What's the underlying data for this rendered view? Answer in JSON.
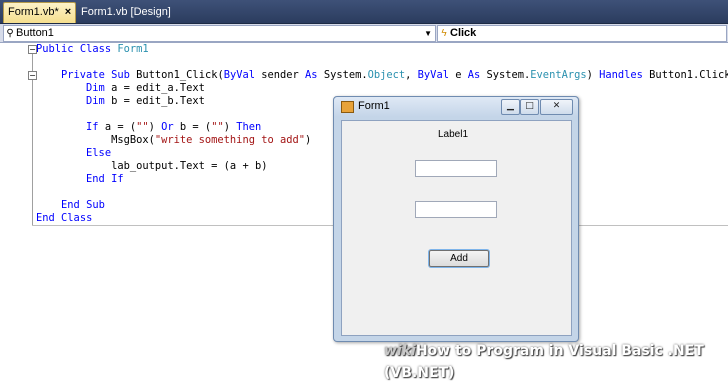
{
  "tabs": [
    {
      "label": "Form1.vb*",
      "close": "×",
      "active": true
    },
    {
      "label": "Form1.vb [Design]",
      "active": false
    }
  ],
  "dropdowns": {
    "object": {
      "value": "Button1",
      "icon": "button-object-icon"
    },
    "event": {
      "value": "Click",
      "icon": "lightning-event-icon"
    }
  },
  "code_lines": [
    "Public Class Form1",
    "",
    "    Private Sub Button1_Click(ByVal sender As System.Object, ByVal e As System.EventArgs) Handles Button1.Click",
    "        Dim a = edit_a.Text",
    "        Dim b = edit_b.Text",
    "",
    "        If a = (\"\") Or b = (\"\") Then",
    "            MsgBox(\"write something to add\")",
    "        Else",
    "            lab_output.Text = (a + b)",
    "        End If",
    "",
    "    End Sub",
    "End Class"
  ],
  "form": {
    "title": "Form1",
    "label": "Label1",
    "button": "Add",
    "textbox_a": "",
    "textbox_b": ""
  },
  "watermark": {
    "prefix": "wiki",
    "text": "How to Program in Visual Basic .NET (VB.NET)"
  },
  "colors": {
    "keyword": "#0000ff",
    "type": "#2b91af",
    "string": "#a31515",
    "tab_active": "#f5df8e"
  }
}
